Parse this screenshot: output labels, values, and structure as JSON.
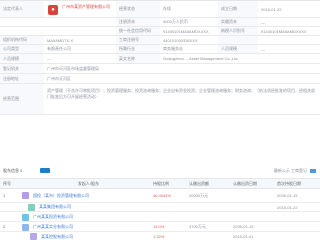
{
  "info": {
    "rows": [
      {
        "c1": "法定代表人",
        "c2": "",
        "c3": "经营状态",
        "c4": "存续",
        "c5": "成立日期",
        "c6": "2015-01-22"
      },
      {
        "c1": "",
        "c2": "",
        "c3": "注册资本",
        "c4": "4000万人民币",
        "c5": "实缴资本",
        "c6": "—"
      },
      {
        "c1": "",
        "c2": "",
        "c3": "统一社会信用代码",
        "c4": "91440101MA5AMDXXXX",
        "c5": "纳税人识别号",
        "c6": "91440101MA5AMDXXXX"
      },
      {
        "c1": "组织机构代码",
        "c2": "MA5AMD7X-X",
        "c3": "工商注册号",
        "c4": "440101000336XXX",
        "c5": "",
        "c6": ""
      },
      {
        "c1": "公司类型",
        "c2": "有限责任公司",
        "c3": "所属行业",
        "c4": "商务服务业",
        "c5": "人员规模",
        "c6": "—"
      },
      {
        "c1": "人员规模",
        "c2": "—",
        "c3": "英文名称",
        "c4": "Guangzhou ... Asset Management Co.,Ltd.",
        "c5": "",
        "c6": ""
      },
      {
        "c1": "登记机关",
        "c2": "广州市天河区市场监督管理局",
        "c3": "",
        "c4": "",
        "c5": "",
        "c6": ""
      },
      {
        "c1": "注册地址",
        "c2": "广州市天河区",
        "c3": "",
        "c4": "",
        "c5": "",
        "c6": ""
      }
    ],
    "company_name": "广州市某资产管理有限公司",
    "scope_label": "经营范围",
    "scope_text": "资产管理（不含许可审批项目）；投资管理服务；投资咨询服务；企业自有资金投资；企业管理咨询服务；财务咨询；（依法须经批准的项目，经相关部门批准后方可开展经营活动）"
  },
  "section": {
    "title": "股东信息",
    "count": "5",
    "right_text": "最新公示  工商登记"
  },
  "holders": {
    "headers": [
      "序号",
      "发起人/股东",
      "持股比例",
      "认缴出资额",
      "认缴出资日期",
      "首次持股日期"
    ],
    "rows": [
      {
        "idx": "1",
        "name": "国投（某市）投资管理有限公司",
        "tag": "大股东",
        "ratio": "46.3544%",
        "amount": "20000万元",
        "date1": "2035-01-15",
        "date2": "2015-01-22"
      },
      {
        "idx": "",
        "name": "某某集团有限公司",
        "tag": "",
        "ratio": "",
        "amount": "",
        "date1": "",
        "date2": ""
      },
      {
        "idx": "2",
        "name": "广州某某投资有限公司",
        "tag": "",
        "ratio": "20.0000%",
        "amount": "8000万元",
        "date1": "2035-01-15",
        "date2": "2015-01-22"
      },
      {
        "idx": "3",
        "name": "广州某某实业有限公司",
        "tag": "",
        "ratio": "15.0%",
        "amount": "4700万元",
        "date1": "2035-01-15",
        "date2": "2015-01-22"
      },
      {
        "idx": "",
        "name": "某某控股有限公司",
        "tag": "",
        "ratio": "1.32%",
        "amount": "",
        "date1": "2015-01-01",
        "date2": "2015-01-22"
      }
    ]
  },
  "colors": {
    "accent": "#3b7bd6",
    "brand": "#d6453d",
    "header_bg": "#f4f7fb"
  }
}
